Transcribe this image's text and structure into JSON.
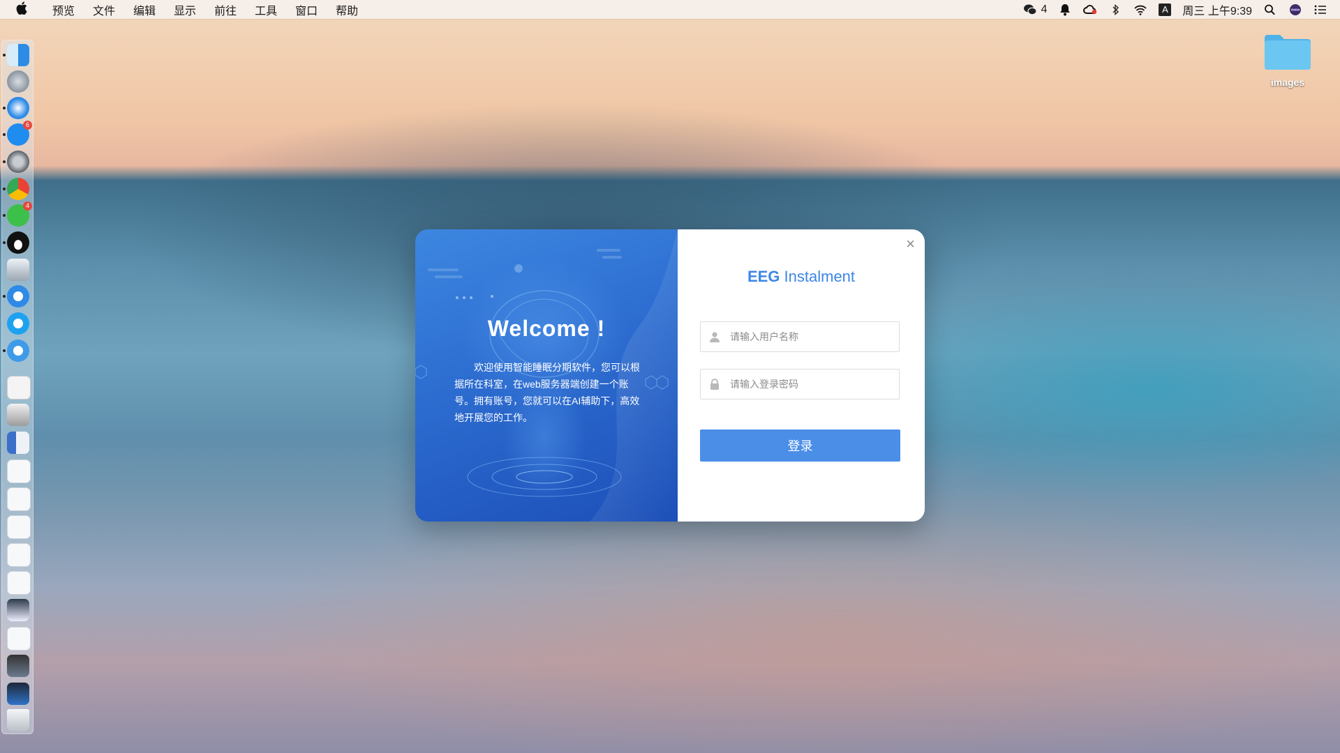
{
  "menubar": {
    "items": [
      "预览",
      "文件",
      "编辑",
      "显示",
      "前往",
      "工具",
      "窗口",
      "帮助"
    ],
    "wechat_count": "4",
    "input_method": "A",
    "clock": "周三 上午9:39"
  },
  "dock": {
    "appstore_badge": "6",
    "wechat_badge": "4"
  },
  "desktop": {
    "folder_label": "images"
  },
  "dialog": {
    "welcome": "Welcome !",
    "intro": "欢迎使用智能睡眠分期软件，您可以根据所在科室，在web服务器端创建一个账号。拥有账号，您就可以在AI辅助下，高效地开展您的工作。",
    "brand_bold": "EEG",
    "brand_rest": " Instalment",
    "username_placeholder": "请输入用户名称",
    "password_placeholder": "请输入登录密码",
    "login_label": "登录",
    "close_glyph": "×"
  },
  "colors": {
    "accent": "#4a8ee8",
    "brand_text": "#3d86e4",
    "left_panel_top": "#3d87e0",
    "left_panel_bottom": "#1c4fb8"
  }
}
